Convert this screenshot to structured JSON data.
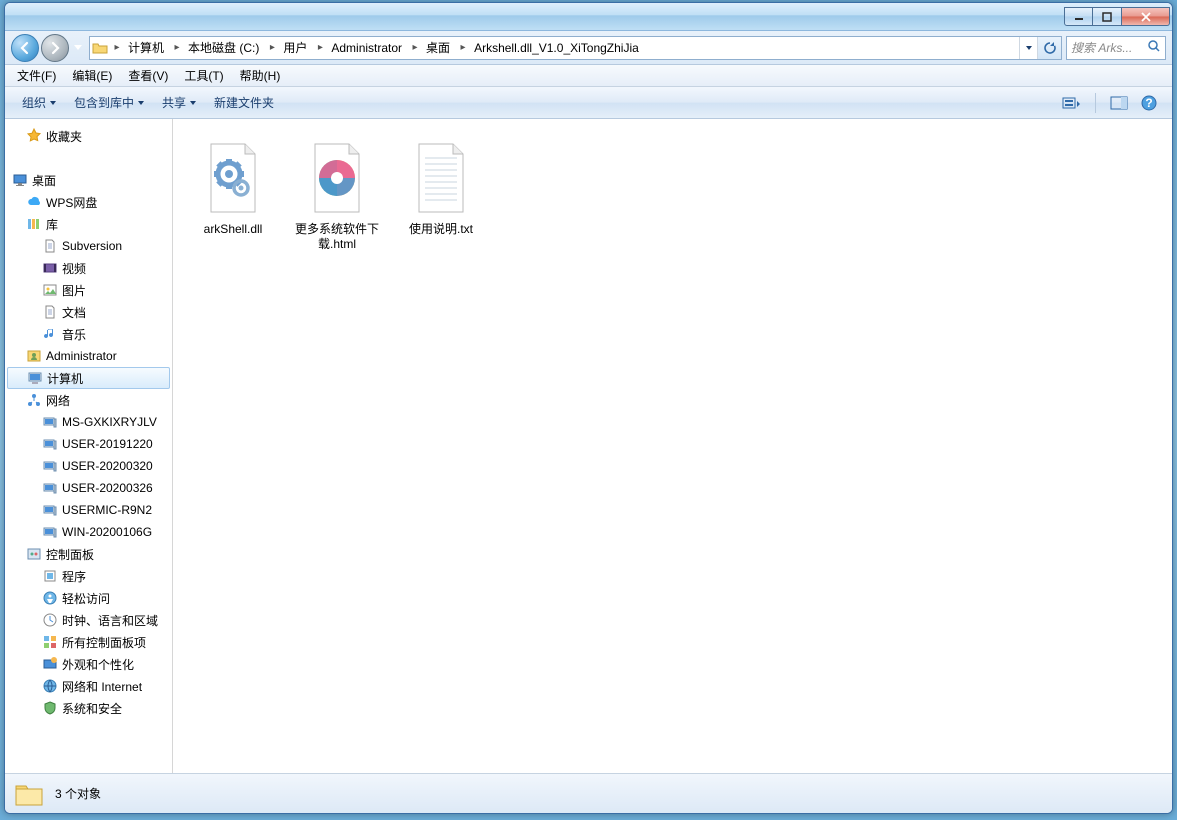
{
  "window": {
    "controls": {
      "min": "_",
      "max": "□",
      "close": "✕"
    }
  },
  "nav": {
    "breadcrumbs": [
      "计算机",
      "本地磁盘 (C:)",
      "用户",
      "Administrator",
      "桌面",
      "Arkshell.dll_V1.0_XiTongZhiJia"
    ],
    "search_placeholder": "搜索 Arks..."
  },
  "menu": {
    "items": [
      "文件(F)",
      "编辑(E)",
      "查看(V)",
      "工具(T)",
      "帮助(H)"
    ]
  },
  "toolbar": {
    "organize": "组织",
    "include": "包含到库中",
    "share": "共享",
    "newfolder": "新建文件夹"
  },
  "sidebar": {
    "favorites": "收藏夹",
    "desktop": "桌面",
    "items": [
      {
        "label": "WPS网盘",
        "indent": 1,
        "icon": "cloud"
      },
      {
        "label": "库",
        "indent": 1,
        "icon": "library"
      },
      {
        "label": "Subversion",
        "indent": 2,
        "icon": "doc"
      },
      {
        "label": "视频",
        "indent": 2,
        "icon": "video"
      },
      {
        "label": "图片",
        "indent": 2,
        "icon": "picture"
      },
      {
        "label": "文档",
        "indent": 2,
        "icon": "doc"
      },
      {
        "label": "音乐",
        "indent": 2,
        "icon": "music"
      },
      {
        "label": "Administrator",
        "indent": 1,
        "icon": "user"
      },
      {
        "label": "计算机",
        "indent": 1,
        "icon": "computer",
        "selected": true
      },
      {
        "label": "网络",
        "indent": 1,
        "icon": "network"
      },
      {
        "label": "MS-GXKIXRYJLV",
        "indent": 2,
        "icon": "pc"
      },
      {
        "label": "USER-20191220",
        "indent": 2,
        "icon": "pc"
      },
      {
        "label": "USER-20200320",
        "indent": 2,
        "icon": "pc"
      },
      {
        "label": "USER-20200326",
        "indent": 2,
        "icon": "pc"
      },
      {
        "label": "USERMIC-R9N2",
        "indent": 2,
        "icon": "pc"
      },
      {
        "label": "WIN-20200106G",
        "indent": 2,
        "icon": "pc"
      },
      {
        "label": "控制面板",
        "indent": 1,
        "icon": "control"
      },
      {
        "label": "程序",
        "indent": 2,
        "icon": "program"
      },
      {
        "label": "轻松访问",
        "indent": 2,
        "icon": "ease"
      },
      {
        "label": "时钟、语言和区域",
        "indent": 2,
        "icon": "clock"
      },
      {
        "label": "所有控制面板项",
        "indent": 2,
        "icon": "allcp"
      },
      {
        "label": "外观和个性化",
        "indent": 2,
        "icon": "appearance"
      },
      {
        "label": "网络和 Internet",
        "indent": 2,
        "icon": "netint"
      },
      {
        "label": "系统和安全",
        "indent": 2,
        "icon": "security"
      }
    ]
  },
  "files": [
    {
      "name": "arkShell.dll",
      "icon": "dll"
    },
    {
      "name": "更多系统软件下载.html",
      "icon": "html"
    },
    {
      "name": "使用说明.txt",
      "icon": "txt"
    }
  ],
  "status": {
    "text": "3 个对象"
  }
}
